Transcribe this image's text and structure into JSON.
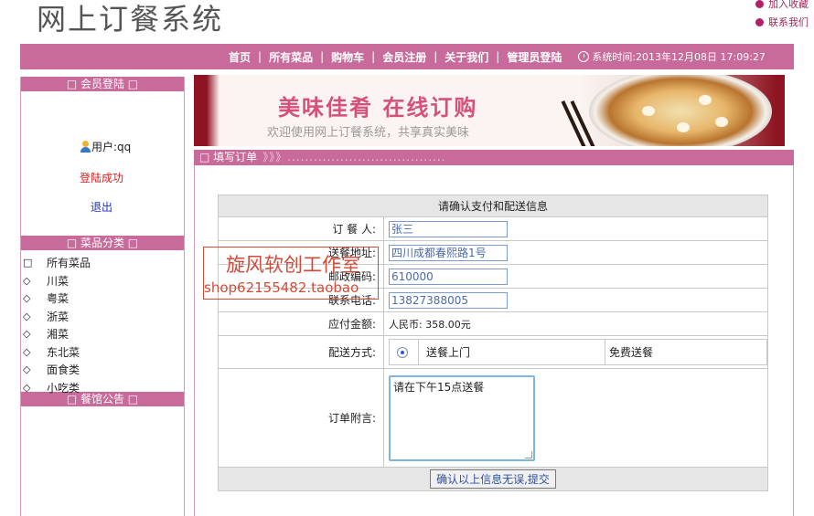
{
  "header": {
    "site_title": "网上订餐系统",
    "links": [
      {
        "label": "加入收藏",
        "icon": "dot-icon"
      },
      {
        "label": "联系我们",
        "icon": "dot-icon"
      }
    ]
  },
  "nav": {
    "items": [
      "首页",
      "所有菜品",
      "购物车",
      "会员注册",
      "关于我们",
      "管理员登陆"
    ],
    "separator": "|",
    "time_label": "系统时间:2013年12月08日 17:09:27"
  },
  "sidebar": {
    "member_login_title": "□ 会员登陆 □",
    "user_label": "用户:qq",
    "login_status": "登陆成功",
    "logout_label": "退出",
    "category_title": "□ 菜品分类 □",
    "categories": [
      {
        "bullet": "□",
        "label": "所有菜品"
      },
      {
        "bullet": "◇",
        "label": "川菜"
      },
      {
        "bullet": "◇",
        "label": "粤菜"
      },
      {
        "bullet": "◇",
        "label": "浙菜"
      },
      {
        "bullet": "◇",
        "label": "湘菜"
      },
      {
        "bullet": "◇",
        "label": "东北菜"
      },
      {
        "bullet": "◇",
        "label": "面食类"
      },
      {
        "bullet": "◇",
        "label": "小吃类"
      }
    ],
    "notice_title": "□ 餐馆公告 □"
  },
  "banner": {
    "title": "美味佳肴 在线订购",
    "subtitle": "欢迎使用网上订餐系统，共享真实美味"
  },
  "section": {
    "title": "□ 填写订单",
    "arrows": "》》》...................................."
  },
  "form": {
    "heading": "请确认支付和配送信息",
    "fields": [
      {
        "label": "订 餐 人:",
        "value": "张三"
      },
      {
        "label": "送餐地址:",
        "value": "四川成都春熙路1号"
      },
      {
        "label": "邮政编码:",
        "value": "610000"
      },
      {
        "label": "联系电话:",
        "value": "13827388005"
      }
    ],
    "amount_label": "应付金额:",
    "amount_value": "人民币: 358.00元",
    "delivery_label": "配送方式:",
    "delivery_option": "送餐上门",
    "delivery_note": "免费送餐",
    "remark_label": "订单附言:",
    "remark_value": "请在下午15点送餐",
    "submit_label": "确认以上信息无误,提交"
  },
  "watermark": {
    "line1": "旋风软创工作室",
    "line2": "shop62155482.taobao"
  }
}
